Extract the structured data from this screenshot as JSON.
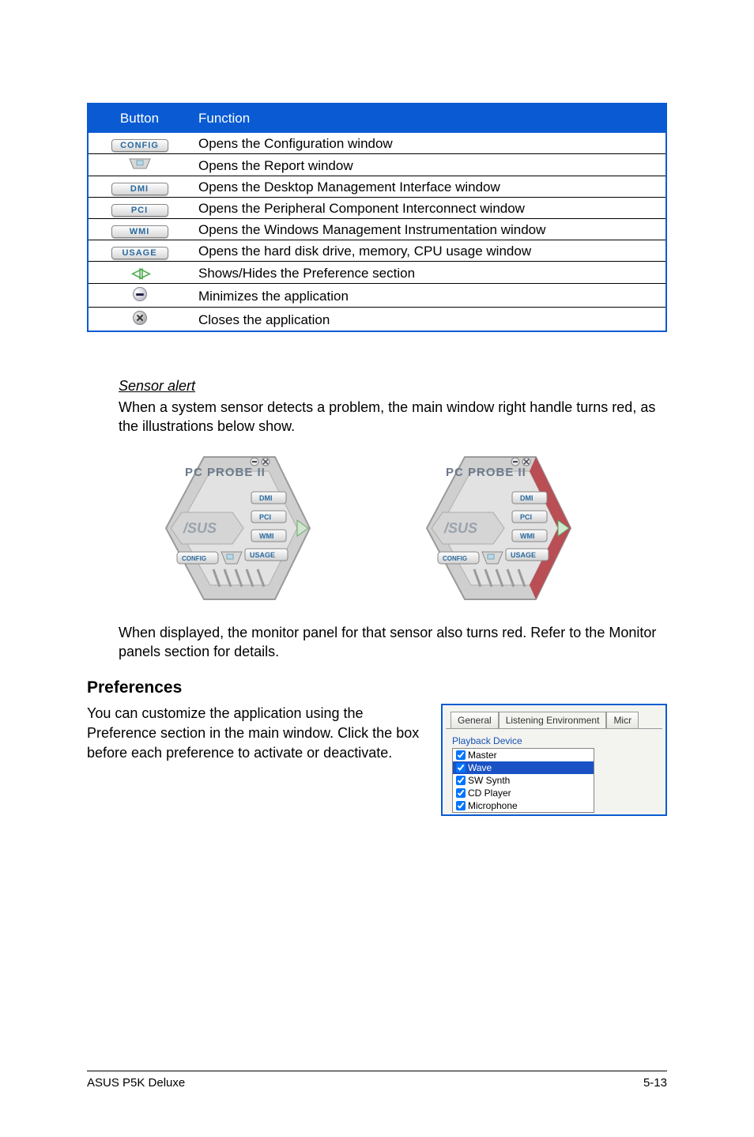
{
  "table": {
    "headers": {
      "button": "Button",
      "function": "Function"
    },
    "rows": [
      {
        "icon": "CONFIG",
        "func": "Opens the Configuration window"
      },
      {
        "icon": "report",
        "func": "Opens the Report window"
      },
      {
        "icon": "DMI",
        "func": "Opens the Desktop Management Interface window"
      },
      {
        "icon": "PCI",
        "func": "Opens the Peripheral Component Interconnect window"
      },
      {
        "icon": "WMI",
        "func": "Opens the Windows Management Instrumentation window"
      },
      {
        "icon": "USAGE",
        "func": "Opens the hard disk drive, memory, CPU usage window"
      },
      {
        "icon": "arrows",
        "func": "Shows/Hides the Preference section"
      },
      {
        "icon": "minimize",
        "func": "Minimizes the application"
      },
      {
        "icon": "close",
        "func": "Closes the application"
      }
    ]
  },
  "sensor": {
    "heading": "Sensor alert",
    "p1": "When a system sensor detects a problem, the main window right handle turns red, as the illustrations below show.",
    "p2": "When displayed, the monitor panel for that sensor also turns red. Refer to the Monitor panels section for details."
  },
  "hex": {
    "title": "PC PROBE II",
    "labels": {
      "dmi": "DMI",
      "pci": "PCI",
      "wmi": "WMI",
      "usage": "USAGE",
      "config": "CONFIG"
    }
  },
  "prefs": {
    "heading": "Preferences",
    "text": "You can customize the application using the Preference section in the main window. Click the box before each preference to activate or deactivate.",
    "tabs": {
      "general": "General",
      "listening": "Listening Environment",
      "micr": "Micr"
    },
    "group": "Playback Device",
    "items": [
      {
        "label": "Master",
        "checked": true,
        "hl": false
      },
      {
        "label": "Wave",
        "checked": true,
        "hl": true
      },
      {
        "label": "SW Synth",
        "checked": true,
        "hl": false
      },
      {
        "label": "CD Player",
        "checked": true,
        "hl": false
      },
      {
        "label": "Microphone",
        "checked": true,
        "hl": false
      }
    ]
  },
  "footer": {
    "left": "ASUS P5K Deluxe",
    "right": "5-13"
  }
}
